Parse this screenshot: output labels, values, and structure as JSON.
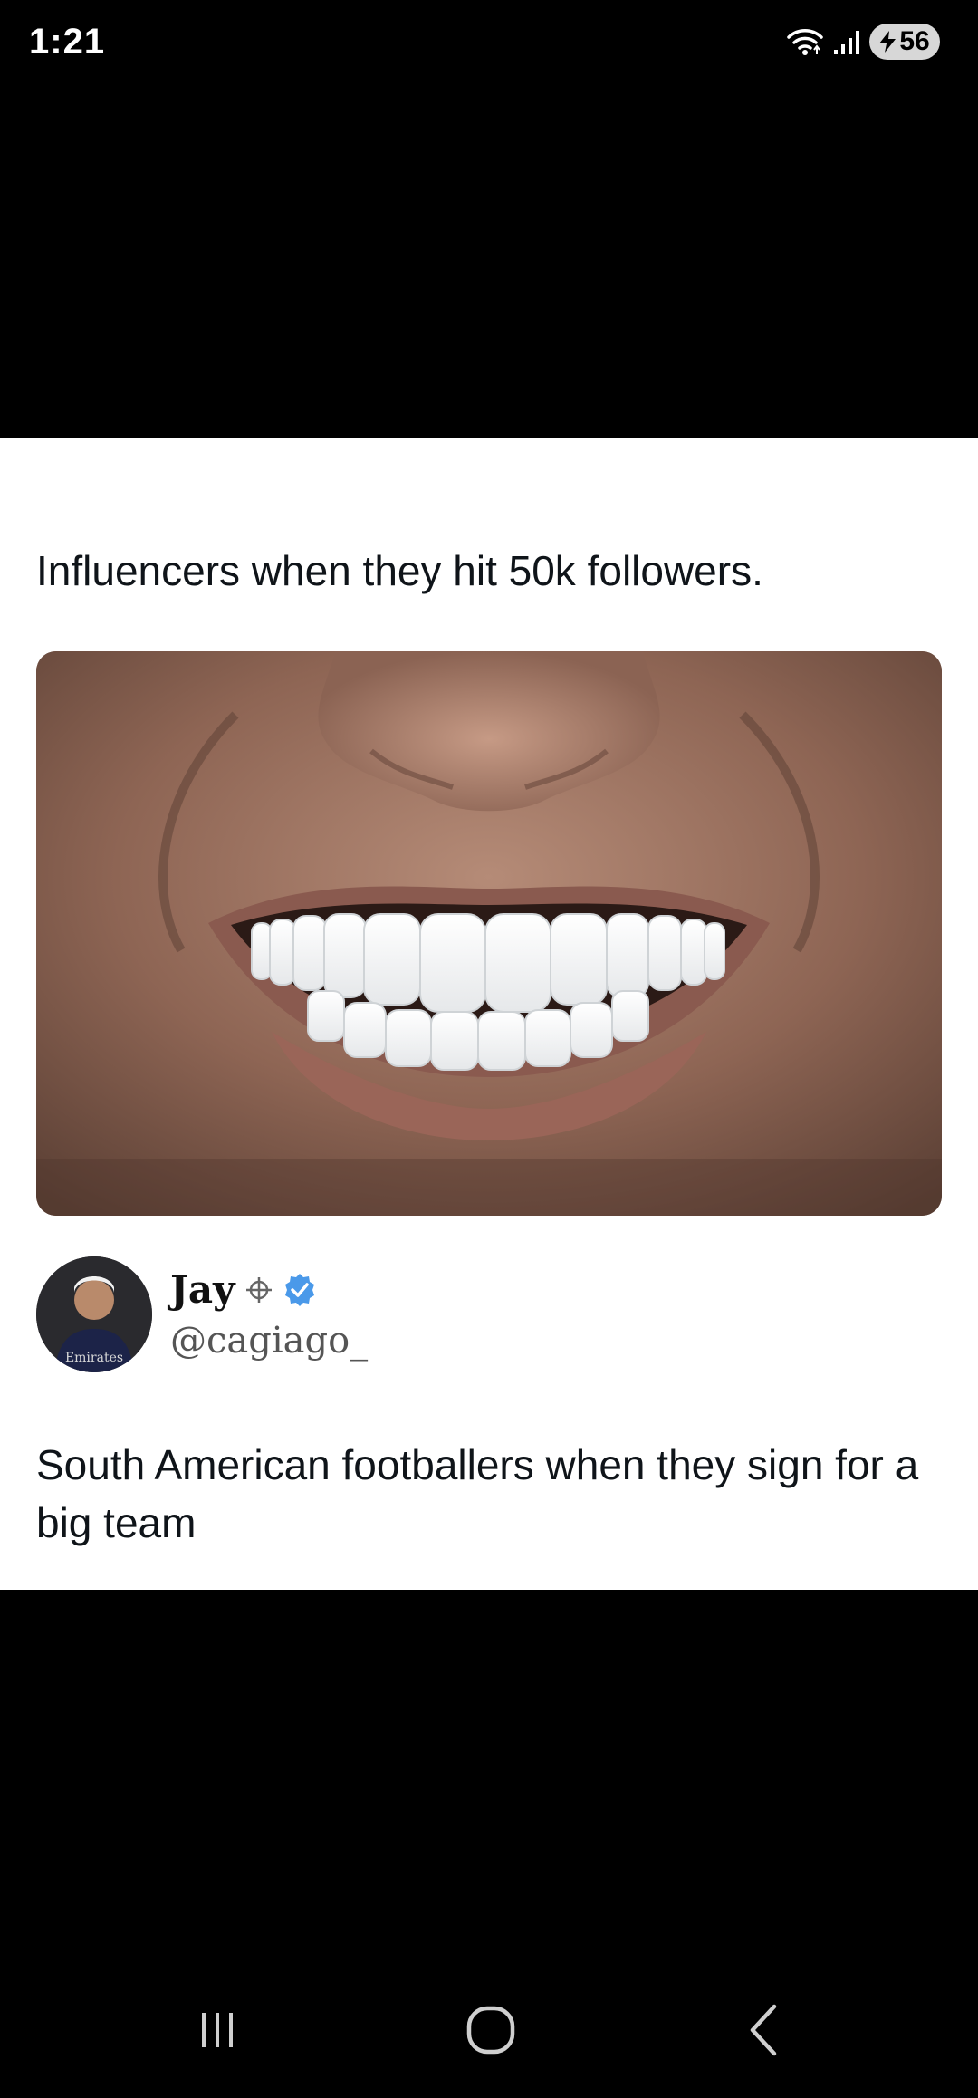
{
  "status_bar": {
    "time": "1:21",
    "battery_level": "56",
    "icons": [
      "wifi-icon",
      "signal-icon",
      "battery-charging-icon"
    ]
  },
  "post": {
    "caption": "Influencers when they hit 50k followers.",
    "image": "close-up-smile-white-teeth"
  },
  "tweet": {
    "display_name": "Jay",
    "handle": "@cagiago_",
    "text": "South American footballers when they sign for a big team",
    "icons": [
      "crosshair-icon",
      "verified-badge-icon"
    ],
    "colors": {
      "verified": "#4a99e9"
    }
  },
  "nav_bar": {
    "icons": [
      "recent-apps-icon",
      "home-icon",
      "back-icon"
    ]
  }
}
